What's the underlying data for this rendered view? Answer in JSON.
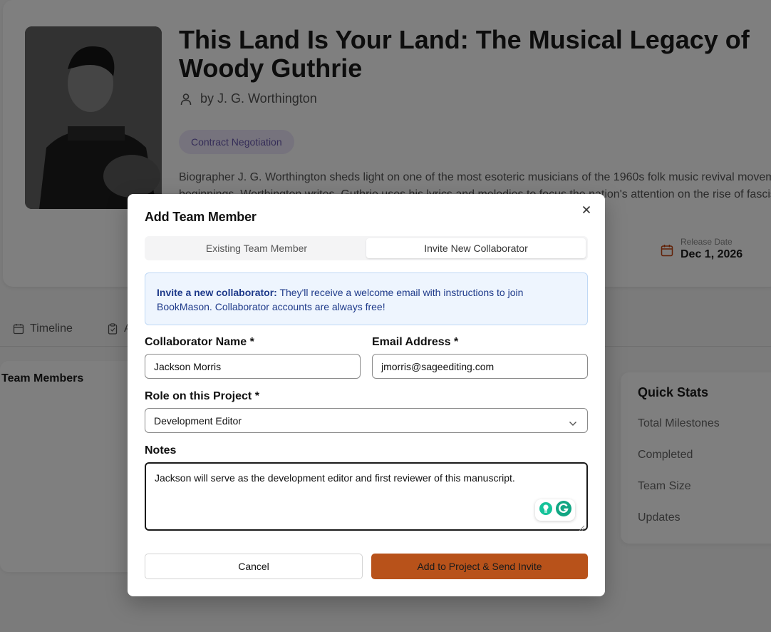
{
  "book": {
    "title": "This Land Is Your Land: The Musical Legacy of Woody Guthrie",
    "author": "by J. G. Worthington",
    "status": "Contract Negotiation",
    "description_line1": "Biographer J. G. Worthington sheds light on one of the most esoteric musicians of the 1960s folk music revival movement",
    "description_line2": "beginnings. Worthington writes, Guthrie uses his lyrics and melodies to focus the nation's attention on the rise of fascism",
    "release_label": "Release Date",
    "release_value": "Dec 1, 2026"
  },
  "tabs": [
    {
      "label": "Timeline",
      "icon": "calendar-icon"
    },
    {
      "label": "A",
      "icon": "clipboard-icon"
    }
  ],
  "team_panel": {
    "title": "Team Members"
  },
  "quick_stats": {
    "title": "Quick Stats",
    "rows": [
      "Total Milestones",
      "Completed",
      "Team Size",
      "Updates"
    ]
  },
  "modal": {
    "title": "Add Team Member",
    "tabs": {
      "existing": "Existing Team Member",
      "invite": "Invite New Collaborator"
    },
    "info_bold": "Invite a new collaborator:",
    "info_text": " They'll receive a welcome email with instructions to join BookMason. Collaborator accounts are always free!",
    "name_label": "Collaborator Name *",
    "name_value": "Jackson Morris",
    "email_label": "Email Address *",
    "email_value": "jmorris@sageediting.com",
    "role_label": "Role on this Project *",
    "role_value": "Development Editor",
    "notes_label": "Notes",
    "notes_value": "Jackson will serve as the development editor and first reviewer of this manuscript.",
    "cancel_label": "Cancel",
    "submit_label": "Add to Project & Send Invite"
  },
  "colors": {
    "primary_button": "#b8521a",
    "info_bg": "#eef5fe",
    "info_text": "#1e3a8a",
    "status_pill_bg": "#ece7fb"
  }
}
